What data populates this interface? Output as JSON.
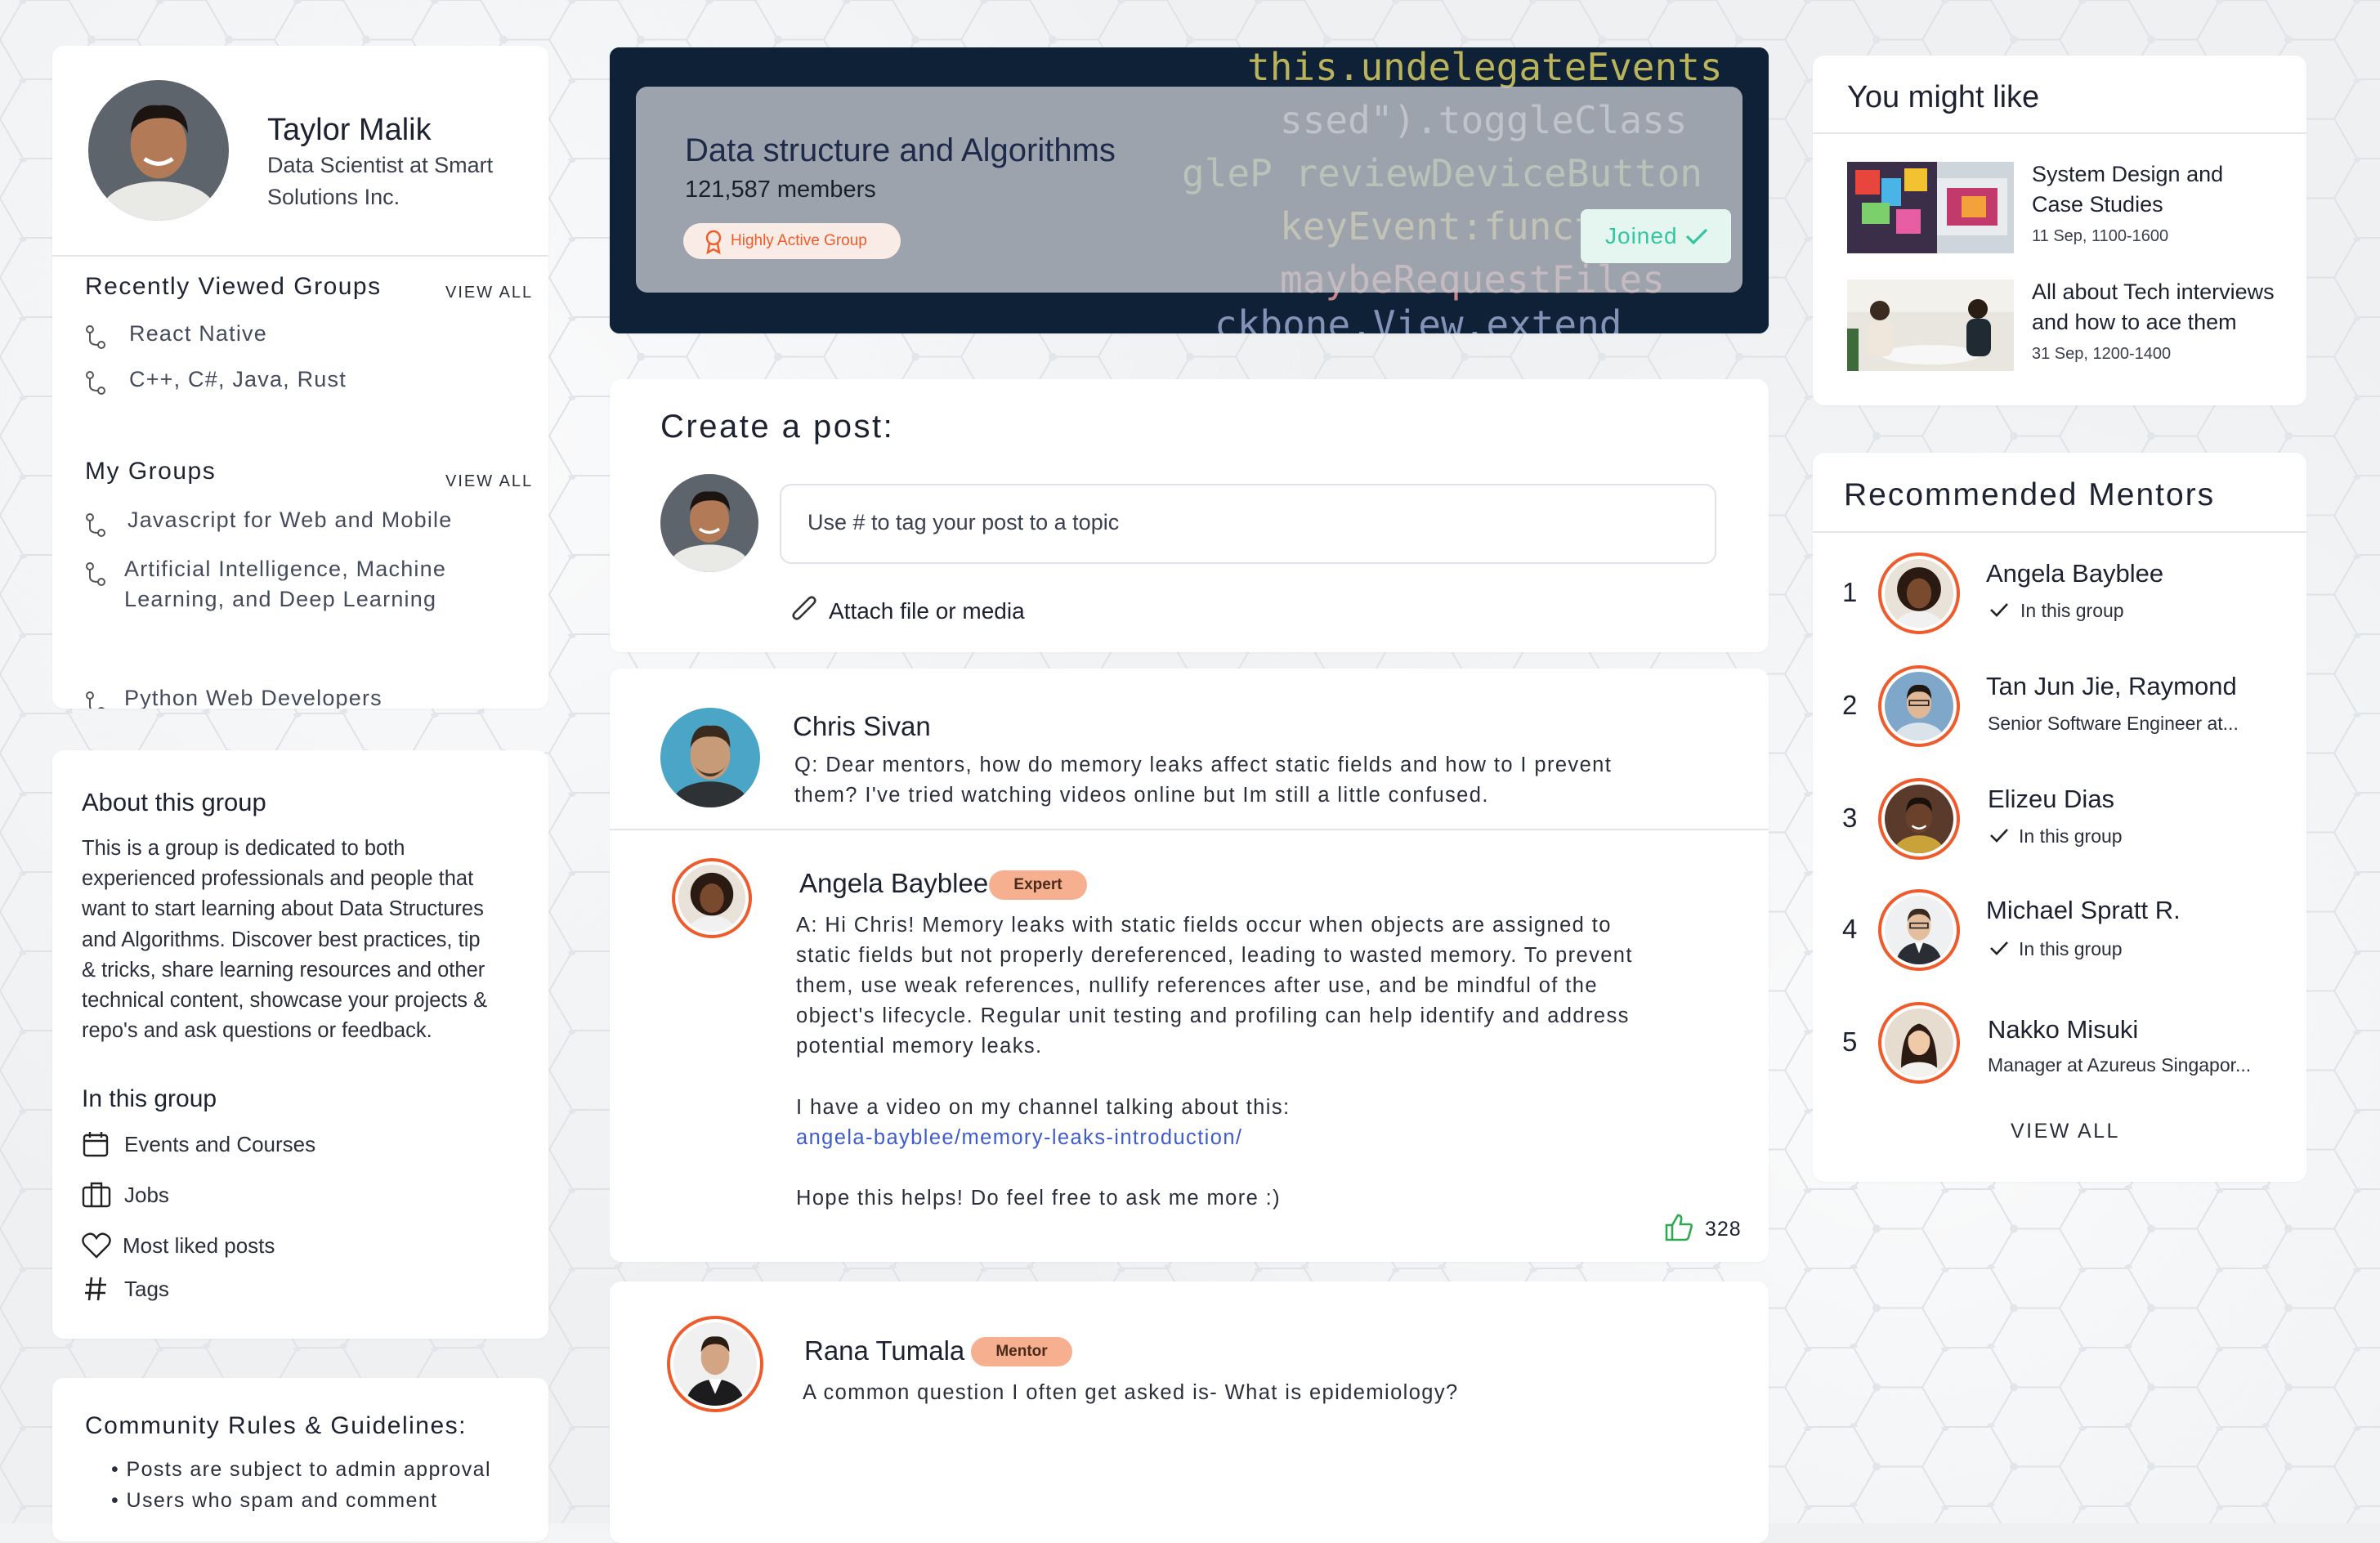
{
  "profile": {
    "name": "Taylor Malik",
    "title_line1": "Data Scientist at Smart",
    "title_line2": "Solutions Inc."
  },
  "recently_viewed": {
    "heading": "Recently Viewed Groups",
    "view_all": "VIEW ALL",
    "items": [
      "React Native",
      "C++, C#, Java, Rust"
    ]
  },
  "my_groups": {
    "heading": "My Groups",
    "view_all": "VIEW ALL",
    "items": [
      {
        "line1": "Javascript for Web and Mobile"
      },
      {
        "line1": "Artificial Intelligence, Machine",
        "line2": "Learning, and Deep Learning"
      },
      {
        "line1": "Python Web Developers"
      }
    ]
  },
  "about": {
    "heading": "About this group",
    "lines": [
      "This is a group is dedicated to both",
      "experienced professionals and people that",
      "want to start learning about Data Structures",
      "and Algorithms. Discover best practices, tip",
      "& tricks, share learning resources  and other",
      "technical content, showcase your projects &",
      "repo's and ask questions or feedback."
    ],
    "in_group_heading": "In this group",
    "links": [
      "Events and Courses",
      "Jobs",
      "Most liked posts",
      "Tags"
    ],
    "link_icons": [
      "calendar-icon",
      "briefcase-icon",
      "heart-icon",
      "hashtag-icon"
    ]
  },
  "rules": {
    "heading": "Community Rules & Guidelines:",
    "items": [
      "Posts are subject to admin approval",
      "Users who spam and comment"
    ]
  },
  "group": {
    "name": "Data structure and Algorithms",
    "members": "121,587 members",
    "badge": "Highly Active Group",
    "joined_label": "Joined",
    "code_lines": [
      "this.undelegateEvents",
      "ssed\").toggleClass",
      "gleP reviewDeviceButton",
      "keyEvent:function",
      "maybeRequestFiles",
      "ckbone.View.extend"
    ]
  },
  "create_post": {
    "heading": "Create a post:",
    "placeholder": "Use # to tag your post to a topic",
    "attach_label": "Attach file or media"
  },
  "post1": {
    "author": "Chris Sivan",
    "question_lines": [
      "Q: Dear mentors, how do memory leaks affect static fields and how to I prevent",
      "them? I've tried watching videos online but Im still a little confused."
    ],
    "reply": {
      "author": "Angela Bayblee",
      "badge": "Expert",
      "answer_lines": [
        "A: Hi Chris! Memory leaks with static fields occur when objects are assigned to",
        "static fields but not properly dereferenced, leading to wasted memory. To prevent",
        "them, use weak references, nullify references after use, and be mindful of the",
        "object's lifecycle. Regular unit testing and profiling can help identify and address",
        "potential memory leaks."
      ],
      "video_intro": "I have a video on my channel talking about this:",
      "link": "angela-bayblee/memory-leaks-introduction/",
      "closing": "Hope this helps! Do feel free to ask me more :)",
      "likes": "328"
    }
  },
  "post2": {
    "author": "Rana Tumala",
    "badge": "Mentor",
    "text": "A common question I often get asked is- What is epidemiology?"
  },
  "you_might_like": {
    "heading": "You might like",
    "items": [
      {
        "title_line1": "System Design and",
        "title_line2": "Case Studies",
        "date": "11 Sep, 1100-1600"
      },
      {
        "title_line1": "All about Tech interviews",
        "title_line2": "and how to ace them",
        "date": "31 Sep, 1200-1400"
      }
    ]
  },
  "mentors": {
    "heading": "Recommended Mentors",
    "view_all": "VIEW ALL",
    "items": [
      {
        "rank": "1",
        "name": "Angela Bayblee",
        "sub": "In this group",
        "check": true
      },
      {
        "rank": "2",
        "name": "Tan Jun Jie, Raymond",
        "sub": "Senior Software Engineer at...",
        "check": false
      },
      {
        "rank": "3",
        "name": "Elizeu Dias",
        "sub": "In this group",
        "check": true
      },
      {
        "rank": "4",
        "name": "Michael Spratt R.",
        "sub": "In this group",
        "check": true
      },
      {
        "rank": "5",
        "name": "Nakko Misuki",
        "sub": "Manager at Azureus Singapor...",
        "check": false
      }
    ]
  },
  "colors": {
    "accent": "#ef5b2b",
    "link": "#3f5ccc",
    "joined": "#34c6a0",
    "badge": "#f6b08f"
  }
}
